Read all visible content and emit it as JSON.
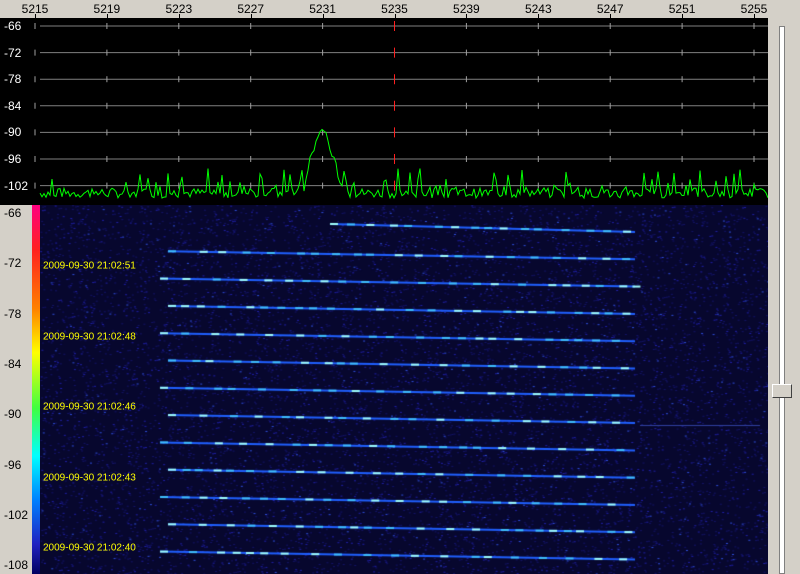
{
  "frequency_axis": {
    "labels": [
      "5215",
      "5219",
      "5223",
      "5227",
      "5231",
      "5235",
      "5239",
      "5243",
      "5247",
      "5251",
      "5255"
    ],
    "center_marker": "5235"
  },
  "spectrum": {
    "db_labels": [
      "-66",
      "-72",
      "-78",
      "-84",
      "-90",
      "-96",
      "-102"
    ],
    "trace_color": "#00ff00",
    "signal_peak_db": -90,
    "signal_center_mhz": 5231
  },
  "waterfall": {
    "db_labels": [
      "-66",
      "-72",
      "-78",
      "-84",
      "-90",
      "-96",
      "-102",
      "-108"
    ],
    "timestamps": [
      "2009-09-30 21:02:51",
      "2009-09-30 21:02:48",
      "2009-09-30 21:02:46",
      "2009-09-30 21:02:43",
      "2009-09-30 21:02:40"
    ]
  },
  "scrollbar": {
    "position_fraction": 0.67
  }
}
